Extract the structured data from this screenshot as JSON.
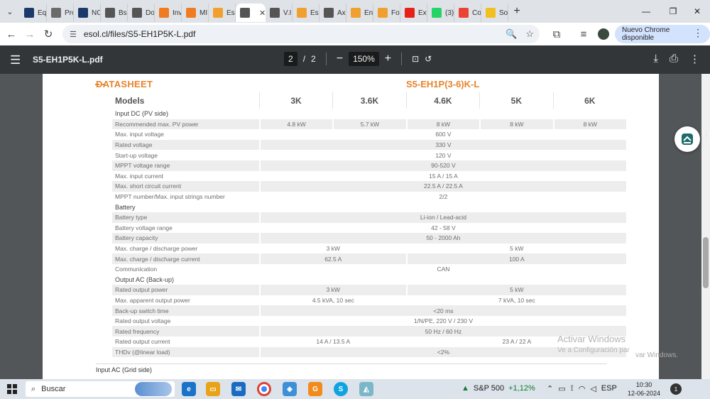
{
  "tabs": [
    {
      "label": "Eq",
      "icon": "isdc-favicon-icon",
      "color": "#1b3a6b"
    },
    {
      "label": "Pro",
      "icon": "gear-favicon-icon",
      "color": "#6b6b6b"
    },
    {
      "label": "NC",
      "icon": "isdc-favicon-icon",
      "color": "#1b3a6b"
    },
    {
      "label": "Bs",
      "icon": "globe-favicon-icon",
      "color": "#555555"
    },
    {
      "label": "Do",
      "icon": "globe-favicon-icon",
      "color": "#555555"
    },
    {
      "label": "Inv",
      "icon": "star-favicon-icon",
      "color": "#f07c22"
    },
    {
      "label": "MI",
      "icon": "star-favicon-icon",
      "color": "#f07c22"
    },
    {
      "label": "Esc",
      "icon": "bars-favicon-icon",
      "color": "#f0a030"
    },
    {
      "label": "",
      "icon": "globe-favicon-icon",
      "color": "#555555"
    },
    {
      "label": "V.I",
      "icon": "globe-favicon-icon",
      "color": "#555555"
    },
    {
      "label": "Esi",
      "icon": "bars-favicon-icon",
      "color": "#f0a030"
    },
    {
      "label": "Ax",
      "icon": "globe-favicon-icon",
      "color": "#555555"
    },
    {
      "label": "En",
      "icon": "square-favicon-icon",
      "color": "#f0a030"
    },
    {
      "label": "Fo",
      "icon": "square-favicon-icon",
      "color": "#f0a030"
    },
    {
      "label": "Ex",
      "icon": "youtube-favicon-icon",
      "color": "#e62117"
    },
    {
      "label": "(3)",
      "icon": "whatsapp-favicon-icon",
      "color": "#25d366"
    },
    {
      "label": "Co",
      "icon": "gmail-favicon-icon",
      "color": "#ea4335"
    },
    {
      "label": "So",
      "icon": "square-favicon-icon",
      "color": "#f0c020"
    }
  ],
  "address_bar": {
    "url": "esol.cl/files/S5-EH1P5K-L.pdf",
    "update_pill": "Nuevo Chrome disponible"
  },
  "pdf_toolbar": {
    "title": "S5-EH1P5K-L.pdf",
    "current_page": "2",
    "page_separator": "/",
    "total_pages": "2",
    "zoom": "150%"
  },
  "document": {
    "heading": "DATASHEET",
    "model_heading": "S5-EH1P(3-6)K-L",
    "models_label": "Models",
    "models": [
      "3K",
      "3.6K",
      "4.6K",
      "5K",
      "6K"
    ],
    "rows": [
      {
        "kind": "section",
        "label": "Input DC (PV side)"
      },
      {
        "kind": "gray",
        "label": "Recommended max. PV power",
        "cells": [
          {
            "v": "4.8 kW",
            "span": 1
          },
          {
            "v": "5.7 kW",
            "span": 1
          },
          {
            "v": "8 kW",
            "span": 1
          },
          {
            "v": "8 kW",
            "span": 1
          },
          {
            "v": "8 kW",
            "span": 1
          }
        ]
      },
      {
        "kind": "white",
        "label": "Max. input voltage",
        "cells": [
          {
            "v": "600 V",
            "span": 5
          }
        ]
      },
      {
        "kind": "gray",
        "label": "Rated voltage",
        "cells": [
          {
            "v": "330 V",
            "span": 5
          }
        ]
      },
      {
        "kind": "white",
        "label": "Start-up voltage",
        "cells": [
          {
            "v": "120 V",
            "span": 5
          }
        ]
      },
      {
        "kind": "gray",
        "label": "MPPT voltage range",
        "cells": [
          {
            "v": "90-520 V",
            "span": 5
          }
        ]
      },
      {
        "kind": "white",
        "label": "Max. input current",
        "cells": [
          {
            "v": "15 A / 15 A",
            "span": 5
          }
        ]
      },
      {
        "kind": "gray",
        "label": "Max. short circuit current",
        "cells": [
          {
            "v": "22.5 A / 22.5 A",
            "span": 5
          }
        ]
      },
      {
        "kind": "white",
        "label": "MPPT number/Max. input strings number",
        "cells": [
          {
            "v": "2/2",
            "span": 5
          }
        ]
      },
      {
        "kind": "section",
        "label": "Battery"
      },
      {
        "kind": "gray",
        "label": "Battery type",
        "cells": [
          {
            "v": "Li-ion / Lead-acid",
            "span": 5
          }
        ]
      },
      {
        "kind": "white",
        "label": "Battery voltage range",
        "cells": [
          {
            "v": "42 - 58 V",
            "span": 5
          }
        ]
      },
      {
        "kind": "gray",
        "label": "Battery capacity",
        "cells": [
          {
            "v": "50 - 2000 Ah",
            "span": 5
          }
        ]
      },
      {
        "kind": "white",
        "label": "Max. charge / discharge power",
        "cells": [
          {
            "v": "3 kW",
            "span": 2
          },
          {
            "v": "5 kW",
            "span": 3
          }
        ]
      },
      {
        "kind": "gray",
        "label": "Max. charge / discharge current",
        "cells": [
          {
            "v": "62.5 A",
            "span": 2
          },
          {
            "v": "100 A",
            "span": 3
          }
        ]
      },
      {
        "kind": "white",
        "label": "Communication",
        "cells": [
          {
            "v": "CAN",
            "span": 5
          }
        ]
      },
      {
        "kind": "section",
        "label": "Output AC (Back-up)"
      },
      {
        "kind": "gray",
        "label": "Rated output power",
        "cells": [
          {
            "v": "3 kW",
            "span": 2
          },
          {
            "v": "5 kW",
            "span": 3
          }
        ]
      },
      {
        "kind": "white",
        "label": "Max. apparent output power",
        "cells": [
          {
            "v": "4.5 kVA, 10 sec",
            "span": 2
          },
          {
            "v": "7 kVA, 10 sec",
            "span": 3
          }
        ]
      },
      {
        "kind": "gray",
        "label": "Back-up switch time",
        "cells": [
          {
            "v": "<20 ms",
            "span": 5
          }
        ]
      },
      {
        "kind": "white",
        "label": "Rated output voltage",
        "cells": [
          {
            "v": "1/N/PE, 220 V / 230 V",
            "span": 5
          }
        ]
      },
      {
        "kind": "gray",
        "label": "Rated frequency",
        "cells": [
          {
            "v": "50 Hz / 60 Hz",
            "span": 5
          }
        ]
      },
      {
        "kind": "white",
        "label": "Rated output current",
        "cells": [
          {
            "v": "14 A / 13.5 A",
            "span": 2
          },
          {
            "v": "23 A / 22 A",
            "span": 3
          }
        ]
      },
      {
        "kind": "gray",
        "label": "THDv (@linear load)",
        "cells": [
          {
            "v": "<2%",
            "span": 5
          }
        ]
      }
    ],
    "next_section": "Input AC (Grid side)"
  },
  "watermark": {
    "line1": "Activar Windows",
    "line2": "Ve a Configuración par",
    "line3": "var Windows."
  },
  "taskbar": {
    "search_placeholder": "Buscar",
    "stock_name": "S&P 500",
    "stock_change": "+1,12%",
    "language": "ESP",
    "time": "10:30",
    "date": "12-06-2024",
    "notifications": "1"
  },
  "colors": {
    "accent_orange": "#e8832a",
    "pdf_toolbar": "#323639",
    "viewer_bg": "#525659"
  }
}
